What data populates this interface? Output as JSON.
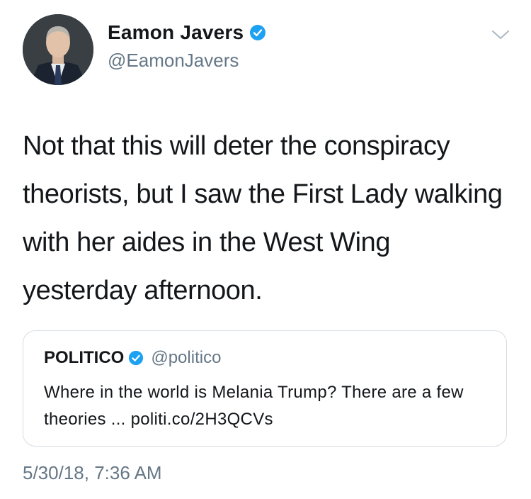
{
  "author": {
    "display_name": "Eamon Javers",
    "handle": "@EamonJavers",
    "verified": true
  },
  "tweet": {
    "text": "Not that this will deter the conspiracy theorists, but I saw the First Lady walking with her aides in the West Wing yesterday afternoon.",
    "timestamp": "5/30/18, 7:36 AM"
  },
  "quoted_tweet": {
    "display_name": "POLITICO",
    "handle": "@politico",
    "verified": true,
    "text": "Where in the world is Melania Trump? There are a few theories ... politi.co/2H3QCVs"
  },
  "icons": {
    "verified": "verified-badge-icon",
    "menu": "chevron-down-icon"
  },
  "colors": {
    "verified_blue": "#1da1f2",
    "secondary_text": "#657786",
    "primary_text": "#14171a",
    "border": "#d6dde3"
  }
}
